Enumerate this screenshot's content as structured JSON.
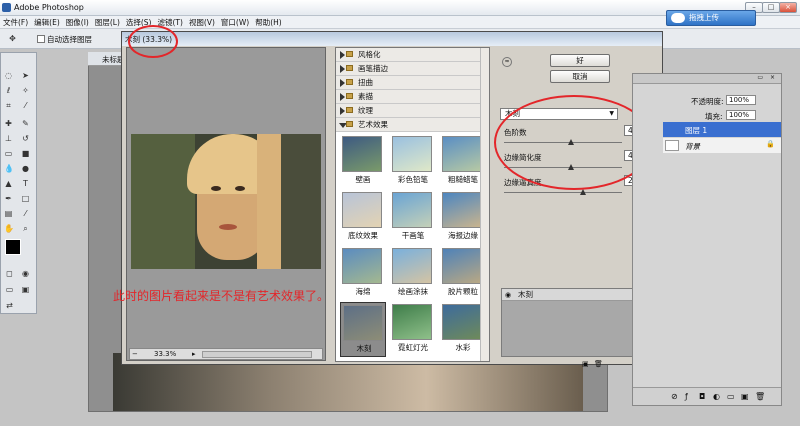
{
  "app": {
    "title": "Adobe Photoshop"
  },
  "menu": [
    "文件(F)",
    "编辑(E)",
    "图像(I)",
    "图层(L)",
    "选择(S)",
    "滤镜(T)",
    "视图(V)",
    "窗口(W)",
    "帮助(H)"
  ],
  "upload_button": "拖拽上传",
  "options": {
    "auto_select_label": "自动选择图层"
  },
  "document": {
    "tab_label": "未标题"
  },
  "filter_gallery": {
    "title": "木刻 (33.3%)",
    "zoom": "33.3%",
    "categories": [
      "风格化",
      "画笔描边",
      "扭曲",
      "素描",
      "纹理",
      "艺术效果"
    ],
    "thumbs": [
      "壁画",
      "彩色铅笔",
      "粗糙蜡笔",
      "底纹效果",
      "干画笔",
      "海报边缘",
      "海绵",
      "绘画涂抹",
      "胶片颗粒",
      "木刻",
      "霓虹灯光",
      "水彩"
    ],
    "ok_label": "好",
    "cancel_label": "取消",
    "selected_filter": "木刻",
    "params": [
      {
        "label": "色阶数",
        "value": "4"
      },
      {
        "label": "边缘简化度",
        "value": "4"
      },
      {
        "label": "边缘逼真度",
        "value": "2"
      }
    ],
    "applied_layer": "木刻"
  },
  "layers": {
    "opacity_label": "不透明度:",
    "opacity_value": "100%",
    "fill_label": "填充:",
    "fill_value": "100%",
    "rows": [
      "图层 1",
      "背景"
    ]
  },
  "annotation": "此时的图片看起来是不是有艺术效果了。",
  "colors": {
    "annotation_red": "#e3262a",
    "title_blue": "#2b5fa8"
  }
}
